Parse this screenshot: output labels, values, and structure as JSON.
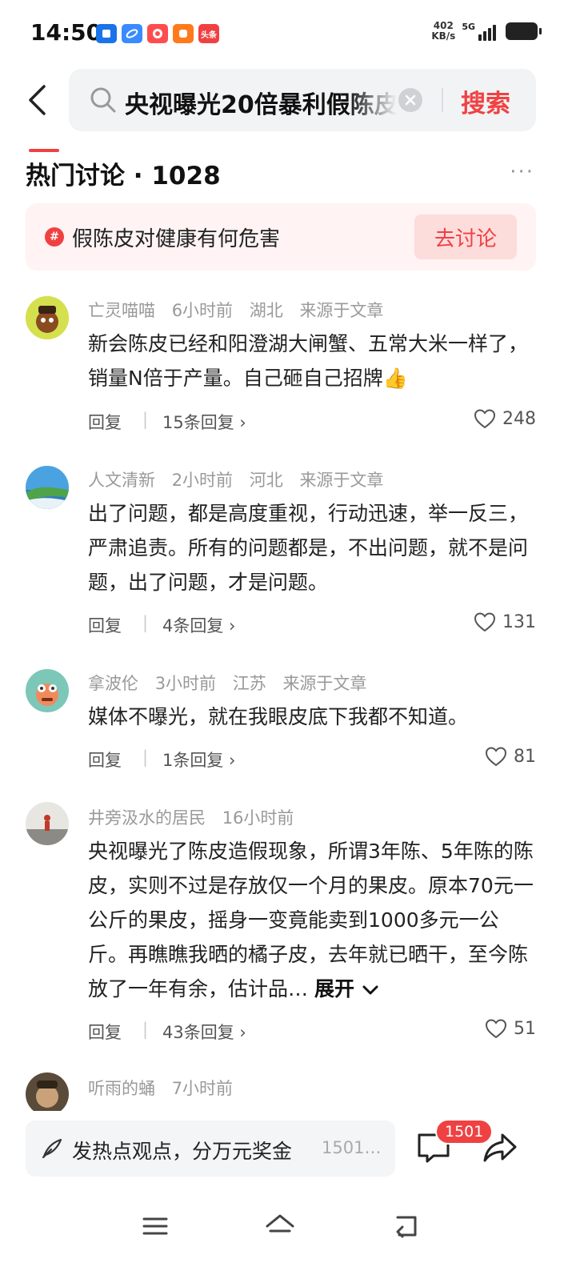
{
  "status_bar": {
    "time": "14:50",
    "net_speed_value": "402",
    "net_speed_unit": "KB/s",
    "signal_label": "5G",
    "app_icons": [
      {
        "name": "blue-app-icon",
        "color": "#1a73e8",
        "label": ""
      },
      {
        "name": "browser-app-icon",
        "color": "#3a8bff",
        "label": ""
      },
      {
        "name": "red-app-icon",
        "color": "#ff4d4f",
        "label": ""
      },
      {
        "name": "orange-app-icon",
        "color": "#ff7a1a",
        "label": ""
      },
      {
        "name": "toutiao-app-icon",
        "color": "#f04142",
        "label": "头条"
      }
    ]
  },
  "search": {
    "query": "央视曝光20倍暴利假陈皮",
    "button_label": "搜索"
  },
  "section": {
    "title": "热门讨论 · 1028",
    "more_label": "···"
  },
  "topic": {
    "icon_text": "#",
    "text": "假陈皮对健康有何危害",
    "button_label": "去讨论"
  },
  "comments": [
    {
      "username": "亡灵喵喵",
      "time": "6小时前",
      "location": "湖北",
      "source": "来源于文章",
      "text": "新会陈皮已经和阳澄湖大闸蟹、五常大米一样了，销量N倍于产量。自己砸自己招牌👍",
      "reply_label": "回复",
      "replies_label": "15条回复 ›",
      "likes": "248"
    },
    {
      "username": "人文清新",
      "time": "2小时前",
      "location": "河北",
      "source": "来源于文章",
      "text": "出了问题，都是高度重视，行动迅速，举一反三，严肃追责。所有的问题都是，不出问题，就不是问题，出了问题，才是问题。",
      "reply_label": "回复",
      "replies_label": "4条回复 ›",
      "likes": "131"
    },
    {
      "username": "拿波伦",
      "time": "3小时前",
      "location": "江苏",
      "source": "来源于文章",
      "text": "媒体不曝光，就在我眼皮底下我都不知道。",
      "reply_label": "回复",
      "replies_label": "1条回复 ›",
      "likes": "81"
    },
    {
      "username": "井旁汲水的居民",
      "time": "16小时前",
      "text": "央视曝光了陈皮造假现象，所谓3年陈、5年陈的陈皮，实则不过是存放仅一个月的果皮。原本70元一公斤的果皮，摇身一变竟能卖到1000多元一公斤。再瞧瞧我晒的橘子皮，去年就已晒干，至今陈放了一年有余，估计品…",
      "expand_label": "展开",
      "reply_label": "回复",
      "replies_label": "43条回复 ›",
      "likes": "51"
    },
    {
      "username": "听雨的蛹",
      "time": "7小时前"
    }
  ],
  "bottom_bar": {
    "compose_placeholder": "发热点观点，分万元奖金",
    "compose_count": "1501…",
    "comment_badge": "1501"
  }
}
